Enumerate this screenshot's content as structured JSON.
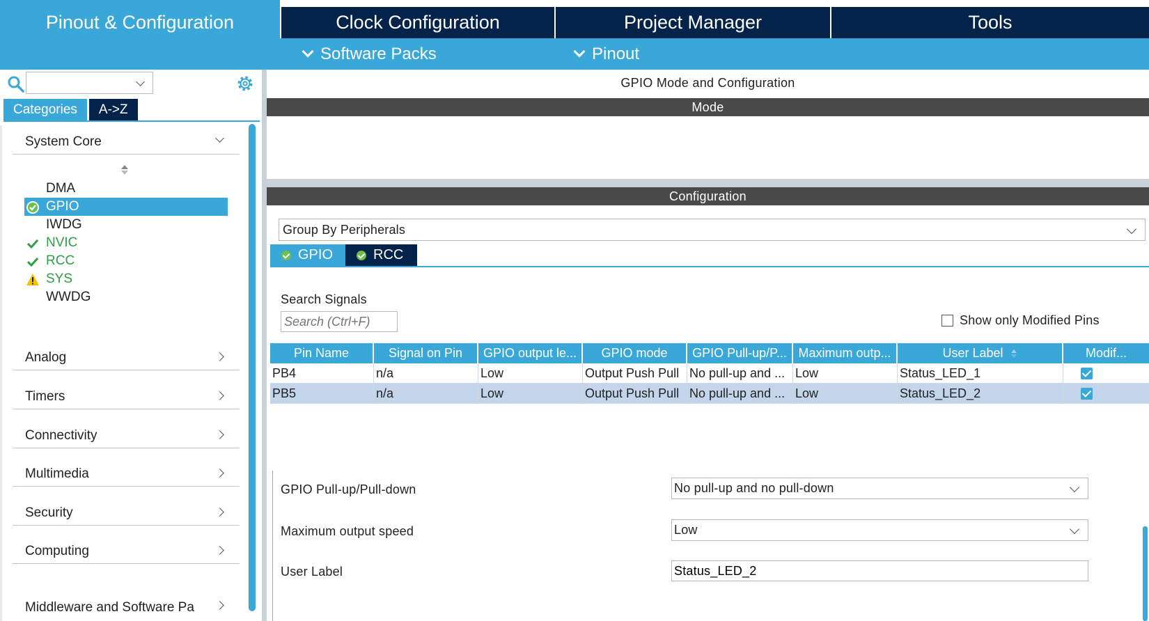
{
  "top_tabs": [
    {
      "label": "Pinout & Configuration",
      "active": true
    },
    {
      "label": "Clock Configuration",
      "active": false
    },
    {
      "label": "Project Manager",
      "active": false
    },
    {
      "label": "Tools",
      "active": false
    }
  ],
  "sub_menu": {
    "software_packs": "Software Packs",
    "pinout": "Pinout"
  },
  "left": {
    "search_value": "",
    "tabs": {
      "categories": "Categories",
      "az": "A->Z"
    },
    "groups": {
      "system_core": "System Core",
      "analog": "Analog",
      "timers": "Timers",
      "connectivity": "Connectivity",
      "multimedia": "Multimedia",
      "security": "Security",
      "computing": "Computing",
      "middleware": "Middleware and Software Pa"
    },
    "core_items": [
      "DMA",
      "GPIO",
      "IWDG",
      "NVIC",
      "RCC",
      "SYS",
      "WWDG"
    ]
  },
  "right": {
    "title": "GPIO Mode and Configuration",
    "mode_bar": "Mode",
    "config_bar": "Configuration",
    "group_by": "Group By Peripherals",
    "periph_tabs": {
      "gpio": "GPIO",
      "rcc": "RCC"
    },
    "search_label": "Search Signals",
    "search_placeholder": "Search (Ctrl+F)",
    "show_modified": "Show only Modified Pins",
    "table": {
      "headers": [
        "Pin Name",
        "Signal on Pin",
        "GPIO output le...",
        "GPIO mode",
        "GPIO Pull-up/P...",
        "Maximum outp...",
        "User Label",
        "Modif..."
      ],
      "rows": [
        [
          "PB4",
          "n/a",
          "Low",
          "Output Push Pull",
          "No pull-up and ...",
          "Low",
          "Status_LED_1"
        ],
        [
          "PB5",
          "n/a",
          "Low",
          "Output Push Pull",
          "No pull-up and ...",
          "Low",
          "Status_LED_2"
        ]
      ]
    },
    "detail": {
      "pull_label": "GPIO Pull-up/Pull-down",
      "pull_value": "No pull-up and no pull-down",
      "speed_label": "Maximum output speed",
      "speed_value": "Low",
      "user_label_label": "User Label",
      "user_label_value": "Status_LED_2"
    }
  },
  "colors": {
    "accent": "#3aa7d9",
    "navy": "#03234b",
    "section_bar": "#494949",
    "selected_row": "#c2d5ea",
    "ok_green": "#2f9e44",
    "warning": "#f2c200"
  },
  "icons": {
    "search": "search-icon",
    "gear": "gear-icon",
    "chevron": "chevron-down-icon",
    "check": "check-icon",
    "warning": "warning-icon"
  }
}
